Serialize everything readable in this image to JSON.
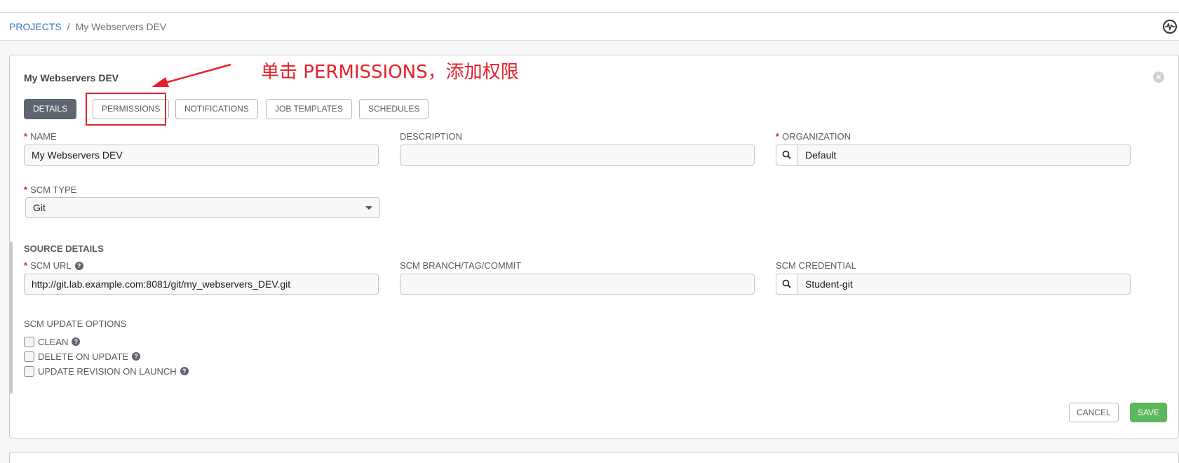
{
  "breadcrumb": {
    "projects_link": "PROJECTS",
    "separator": "/",
    "current": "My Webservers DEV"
  },
  "header": {
    "activity_icon": "activity-stream-icon"
  },
  "panel": {
    "title": "My Webservers DEV",
    "close_icon": "close-icon",
    "tabs": [
      {
        "label": "DETAILS",
        "active": true
      },
      {
        "label": "PERMISSIONS",
        "active": false
      },
      {
        "label": "NOTIFICATIONS",
        "active": false
      },
      {
        "label": "JOB TEMPLATES",
        "active": false
      },
      {
        "label": "SCHEDULES",
        "active": false
      }
    ]
  },
  "annotation": {
    "text": "单击 PERMISSIONS，添加权限",
    "color": "#e8202a"
  },
  "form": {
    "name": {
      "label": "NAME",
      "required": true,
      "value": "My Webservers DEV"
    },
    "description": {
      "label": "DESCRIPTION",
      "value": ""
    },
    "organization": {
      "label": "ORGANIZATION",
      "required": true,
      "value": "Default"
    },
    "scm_type": {
      "label": "SCM TYPE",
      "required": true,
      "value": "Git"
    },
    "source_details_title": "SOURCE DETAILS",
    "scm_url": {
      "label": "SCM URL",
      "required": true,
      "value": "http://git.lab.example.com:8081/git/my_webservers_DEV.git"
    },
    "scm_branch": {
      "label": "SCM BRANCH/TAG/COMMIT",
      "value": ""
    },
    "scm_credential": {
      "label": "SCM CREDENTIAL",
      "value": "Student-git"
    },
    "scm_update_options": {
      "label": "SCM UPDATE OPTIONS",
      "options": [
        {
          "label": "CLEAN",
          "checked": false
        },
        {
          "label": "DELETE ON UPDATE",
          "checked": false
        },
        {
          "label": "UPDATE REVISION ON LAUNCH",
          "checked": false
        }
      ]
    }
  },
  "actions": {
    "cancel_label": "CANCEL",
    "save_label": "SAVE",
    "save_color": "#5cb85c"
  }
}
